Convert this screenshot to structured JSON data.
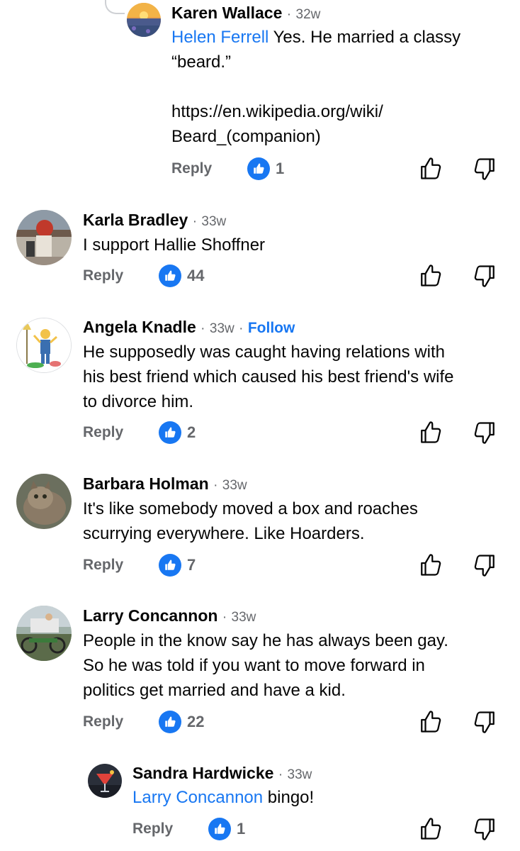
{
  "comments": [
    {
      "name": "Karen Wallace",
      "age": "32w",
      "mention": "Helen Ferrell",
      "lines": [
        "Yes. He married a classy",
        "“beard.”",
        "",
        "https://en.wikipedia.org/wiki/",
        "Beard_(companion)"
      ],
      "reply_label": "Reply",
      "likes": "1",
      "avatar": "avatar-sunset-field"
    },
    {
      "name": "Karla Bradley",
      "age": "33w",
      "lines": [
        "I support Hallie Shoffner"
      ],
      "reply_label": "Reply",
      "likes": "44",
      "avatar": "avatar-mascot-photo"
    },
    {
      "name": "Angela Knadle",
      "age": "33w",
      "follow": "Follow",
      "lines": [
        "He supposedly was caught having relations with",
        "his best friend which caused his best friend's wife",
        "to divorce him."
      ],
      "reply_label": "Reply",
      "likes": "2",
      "avatar": "avatar-cartoon"
    },
    {
      "name": "Barbara Holman",
      "age": "33w",
      "lines": [
        "It's like somebody moved a box and roaches",
        "scurrying everywhere. Like Hoarders."
      ],
      "reply_label": "Reply",
      "likes": "7",
      "avatar": "avatar-cat"
    },
    {
      "name": "Larry Concannon",
      "age": "33w",
      "lines": [
        "People in the know say he has always been gay.",
        "So he was told if you want to move forward in",
        "politics get married and have a kid."
      ],
      "reply_label": "Reply",
      "likes": "22",
      "avatar": "avatar-truck-motorcycle"
    },
    {
      "name": "Sandra Hardwicke",
      "age": "33w",
      "mention": "Larry Concannon",
      "lines": [
        "bingo!"
      ],
      "reply_label": "Reply",
      "likes": "1",
      "avatar": "avatar-cocktail"
    }
  ],
  "separator": "·",
  "icons": {
    "like": "thumbs-up-icon",
    "dislike": "thumbs-down-icon",
    "reaction": "like-reaction-icon"
  },
  "colors": {
    "link": "#1877f2",
    "meta": "#65676b",
    "text": "#050505"
  }
}
